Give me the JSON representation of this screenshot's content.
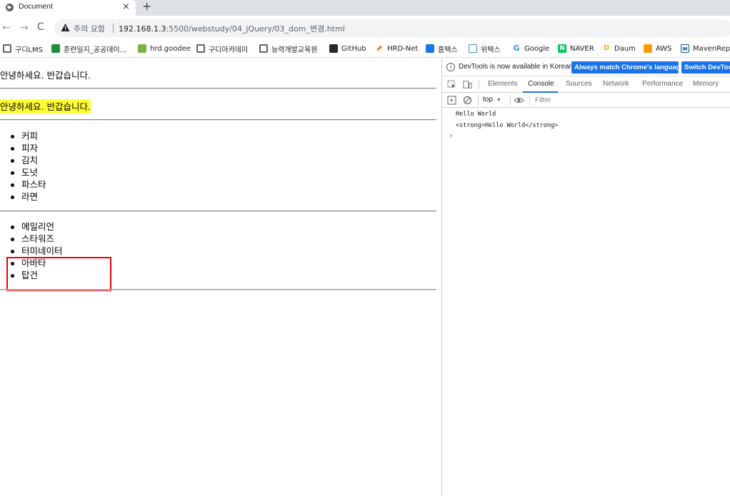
{
  "browser": {
    "tab": {
      "title": "Document",
      "close": "×"
    },
    "new_tab": "+",
    "nav": {
      "back": "←",
      "forward": "→",
      "reload": "C"
    },
    "omnibox": {
      "security_label": "주의 요함",
      "url_host": "192.168.1.3",
      "url_rest": ":5500/webstudy/04_jQuery/03_dom_변경.html"
    },
    "bookmarks": [
      {
        "label": "구디LMS",
        "icon": "globe-icon"
      },
      {
        "label": "훈련일지_공공데이...",
        "icon": "plus-square-icon"
      },
      {
        "label": "hrd.goodee",
        "icon": "leaf-icon"
      },
      {
        "label": "구디아카데미",
        "icon": "globe-icon"
      },
      {
        "label": "능력개발교육원",
        "icon": "globe-icon"
      },
      {
        "label": "GitHub",
        "icon": "github-icon"
      },
      {
        "label": "HRD-Net",
        "icon": "hrd-net-icon"
      },
      {
        "label": "홈택스",
        "icon": "hometax-icon"
      },
      {
        "label": "위택스",
        "icon": "wetax-icon"
      },
      {
        "label": "Google",
        "icon": "google-icon"
      },
      {
        "label": "NAVER",
        "icon": "naver-icon"
      },
      {
        "label": "Daum",
        "icon": "daum-icon"
      },
      {
        "label": "AWS",
        "icon": "aws-icon"
      },
      {
        "label": "MavenRepo",
        "icon": "maven-icon"
      }
    ]
  },
  "page": {
    "greeting1": "안녕하세요. 반갑습니다.",
    "greeting2": "안녕하세요. 반갑습니다.",
    "food_list": [
      "커피",
      "피자",
      "김치",
      "도넛",
      "파스타",
      "라면"
    ],
    "movie_list": [
      "에일리언",
      "스타워즈",
      "터미네이터",
      "아바타",
      "탑건"
    ]
  },
  "devtools": {
    "infobar": {
      "text": "DevTools is now available in Korean!",
      "match_button": "Always match Chrome's language",
      "switch_button": "Switch DevTools"
    },
    "tabs": [
      "Elements",
      "Console",
      "Sources",
      "Network",
      "Performance",
      "Memory"
    ],
    "active_tab": "Console",
    "console": {
      "context": "top",
      "filter_placeholder": "Filter",
      "lines": [
        "Hello World",
        "<strong>Hello World</strong>"
      ],
      "prompt": "›"
    }
  },
  "colors": {
    "highlight_yellow": "#ffff33",
    "annotation_red": "#e8000b",
    "devtools_blue": "#1a73e8"
  }
}
